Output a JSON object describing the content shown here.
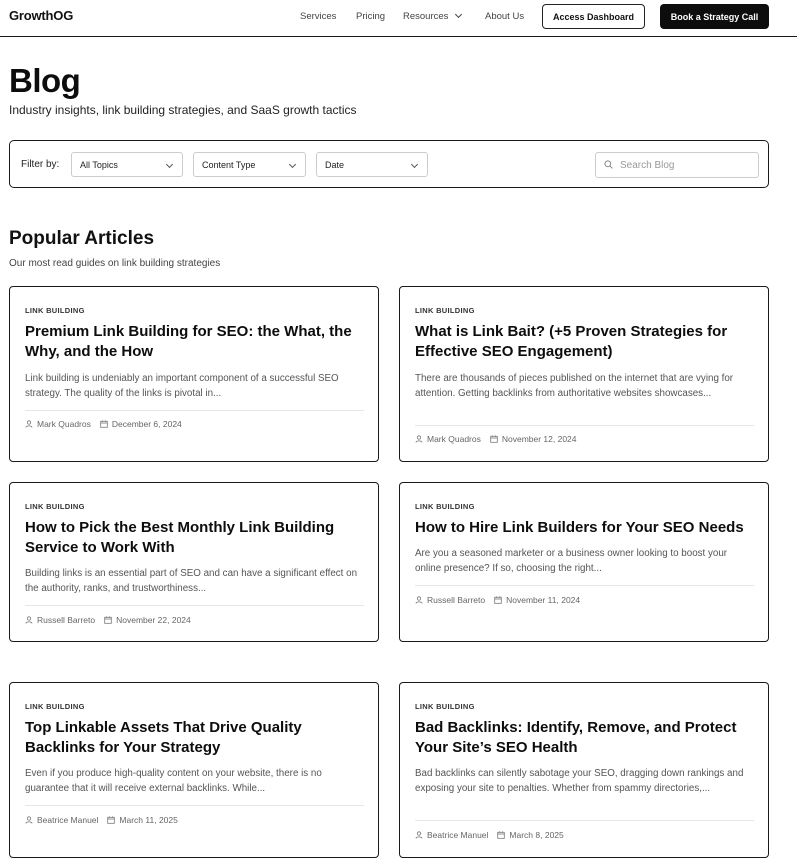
{
  "header": {
    "logo": "GrowthOG",
    "nav": [
      "Services",
      "Pricing",
      "Resources",
      "About Us"
    ],
    "dashboard_label": "Access Dashboard",
    "strategy_label": "Book a Strategy Call"
  },
  "page": {
    "title": "Blog",
    "subtitle": "Industry insights, link building strategies, and SaaS growth tactics"
  },
  "filters": {
    "label": "Filter by:",
    "topics": "All Topics",
    "content_type": "Content Type",
    "date": "Date",
    "search_placeholder": "Search Blog"
  },
  "section": {
    "title": "Popular Articles",
    "subtitle": "Our most read guides on link building strategies"
  },
  "articles": [
    {
      "category": "LINK BUILDING",
      "title": "Premium Link Building for SEO: the What, the Why, and the How",
      "excerpt": "Link building is undeniably an important component of a successful SEO strategy. The quality of the links is pivotal in...",
      "author": "Mark Quadros",
      "date": "December 6, 2024"
    },
    {
      "category": "LINK BUILDING",
      "title": "What is Link Bait? (+5 Proven Strategies for Effective SEO Engagement)",
      "excerpt": "There are thousands of pieces published on the internet that are vying for attention. Getting backlinks from authoritative websites showcases...",
      "author": "Mark Quadros",
      "date": "November 12, 2024"
    },
    {
      "category": "LINK BUILDING",
      "title": "How to Pick the Best Monthly Link Building Service to Work With",
      "excerpt": "Building links is an essential part of SEO and can have a significant effect on the authority, ranks, and trustworthiness...",
      "author": "Russell Barreto",
      "date": "November 22, 2024"
    },
    {
      "category": "LINK BUILDING",
      "title": "How to Hire Link Builders for Your SEO Needs",
      "excerpt": "Are you a seasoned marketer or a business owner looking to boost your online presence? If so, choosing the right...",
      "author": "Russell Barreto",
      "date": "November 11, 2024"
    },
    {
      "category": "LINK BUILDING",
      "title": "Top Linkable Assets That Drive Quality Backlinks for Your Strategy",
      "excerpt": "Even if you produce high-quality content on your website, there is no guarantee that it will receive external backlinks. While...",
      "author": "Beatrice Manuel",
      "date": "March 11, 2025"
    },
    {
      "category": "LINK BUILDING",
      "title": "Bad Backlinks: Identify, Remove, and Protect Your Site’s SEO Health",
      "excerpt": "Bad backlinks can silently sabotage your SEO, dragging down rankings and exposing your site to penalties. Whether from spammy directories,...",
      "author": "Beatrice Manuel",
      "date": "March 8, 2025"
    }
  ]
}
